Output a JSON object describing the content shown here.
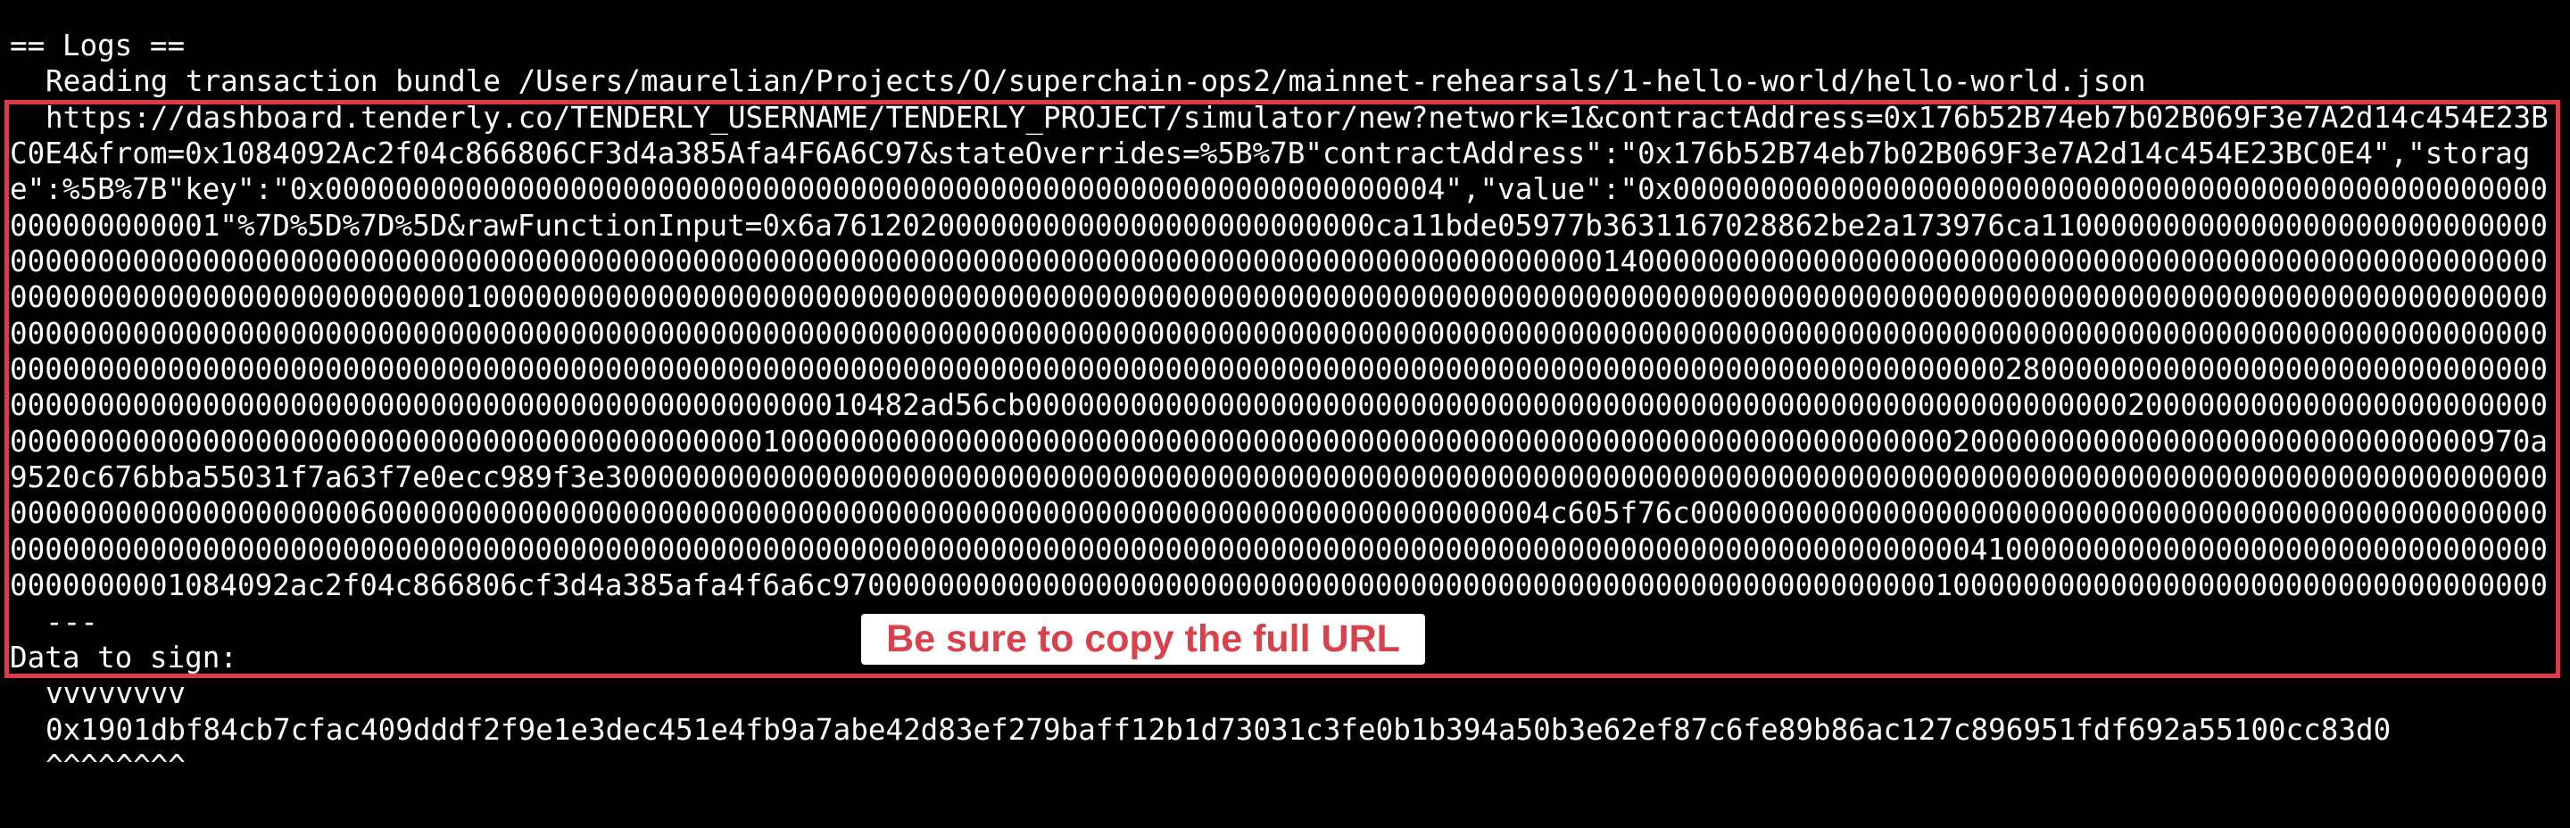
{
  "logs": {
    "header": "== Logs ==",
    "reading_line": "Reading transaction bundle /Users/maurelian/Projects/O/superchain-ops2/mainnet-rehearsals/1-hello-world/hello-world.json",
    "url_lines": [
      "https://dashboard.tenderly.co/TENDERLY_USERNAME/TENDERLY_PROJECT/simulator/new?network=1&contractAddress=0x176b52B74eb7b02B069F3e7A2d14c454E2",
      "3BC0E4&from=0x1084092Ac2f04c866806CF3d4a385Afa4F6A6C97&stateOverrides=%5B%7B\"contractAddress\":\"0x176b52B74eb7b02B069F3e7A2d14c454E23BC0E4\",\"sto",
      "rage\":%5B%7B\"key\":\"0x0000000000000000000000000000000000000000000000000000000000000004\",\"value\":\"0x00000000000000000000000000000000000000000000",
      "000000000000000001\"%7D%5D%7D%5D&rawFunctionInput=0x6a7612020000000000000000000000000ca11bde05977b3631167028862be2a173976ca11000000000000000000000",
      "00000000000000000000000000000000000000000000000000000000000000000000000000000000000000000000000001400000000000000000000000000000000000000000000000",
      "00000000000000000000000000000001000000000000000000000000000000000000000000000000000000000000000000000000000000000000000000000000000000000000000000",
      "00000000000000000000000000000000000000000000000000000000000000000000000000000000000000000000000000000000000000000000000000000000000000000000000000",
      "00000000000000000000000000000000000000000000000000000000000000000000000000000000000000000000000000000000000000000000028000000000000000000000000000",
      "000000000000000000000000000000000000000000000000010482ad56cb000000000000000000000000000000000000000000000000000000000000000200000000000000000000000",
      "000000000000000000000000000000000000000000010000000000000000000000000000000000000000000000000000000000000000000200000000000000000000000000000970a9520c676",
      "bba55031f7a63f7e0ecc989f3e300000000000000000000000000000000000000000000000000000000000000000000000000000000000000000000000000000000000000000000000",
      "0000000000060000000000000000000000000000000000000000000000000000000000000000004c605f76c00000000000000000000000000000000000000000000000000000000000",
      "00000000000000000000000000000000000000000000000000000000000000000000000000000000000000000000000000000041000000000000000000000000000000000000000010",
      "84092ac2f04c866806cf3d4a385afa4f6a6c97000000000000000000000000000000000000000000000000000000000000010000000000000000000000000000000000000000000000",
      "0000000000000000000000000"
    ],
    "separator": "---",
    "data_to_sign_label": "Data to sign:",
    "marker_top": "vvvvvvvv",
    "data_hash": "0x1901dbf84cb7cfac409dddf2f9e1e3dec451e4fb9a7abe42d83ef279baff12b1d73031c3fe0b1b394a50b3e62ef87c6fe89b86ac127c896951fdf692a55100cc83d0",
    "marker_bottom": "^^^^^^^^"
  },
  "annotation": {
    "text": "Be sure to copy the full URL",
    "color": "#d9424c",
    "border_color": "#e0394a"
  }
}
